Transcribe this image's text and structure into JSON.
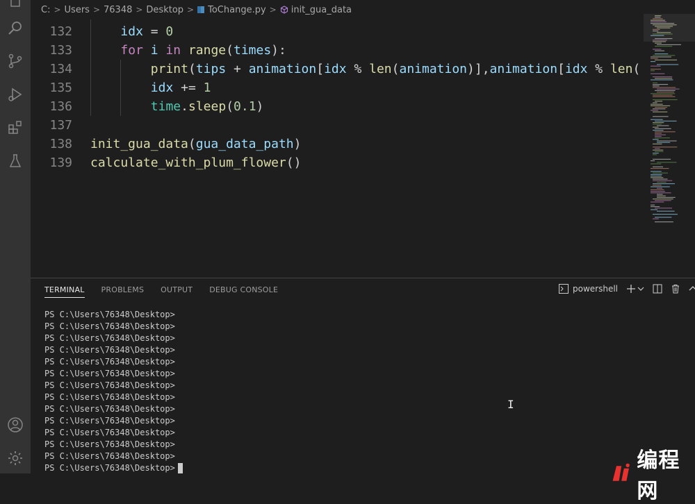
{
  "breadcrumb": {
    "items": [
      "C:",
      "Users",
      "76348",
      "Desktop",
      "ToChange.py",
      "init_gua_data"
    ],
    "separator": ">"
  },
  "editor": {
    "lines": [
      {
        "num": "132",
        "tokens": [
          {
            "t": "idx",
            "c": "vr"
          },
          {
            "t": " = ",
            "c": "op"
          },
          {
            "t": "0",
            "c": "nm"
          }
        ]
      },
      {
        "num": "133",
        "tokens": [
          {
            "t": "for",
            "c": "kw"
          },
          {
            "t": " ",
            "c": "pl"
          },
          {
            "t": "i",
            "c": "vr"
          },
          {
            "t": " in ",
            "c": "kw"
          },
          {
            "t": "range",
            "c": "fn"
          },
          {
            "t": "(",
            "c": "pl"
          },
          {
            "t": "times",
            "c": "vr"
          },
          {
            "t": "):",
            "c": "pl"
          }
        ]
      },
      {
        "num": "134",
        "tokens": [
          {
            "t": "print",
            "c": "fn"
          },
          {
            "t": "(",
            "c": "pl"
          },
          {
            "t": "tips",
            "c": "vr"
          },
          {
            "t": " + ",
            "c": "op"
          },
          {
            "t": "animation",
            "c": "vr"
          },
          {
            "t": "[",
            "c": "pl"
          },
          {
            "t": "idx",
            "c": "vr"
          },
          {
            "t": " % ",
            "c": "op"
          },
          {
            "t": "len",
            "c": "fn"
          },
          {
            "t": "(",
            "c": "pl"
          },
          {
            "t": "animation",
            "c": "vr"
          },
          {
            "t": ")],",
            "c": "pl"
          },
          {
            "t": "animation",
            "c": "vr"
          },
          {
            "t": "[",
            "c": "pl"
          },
          {
            "t": "idx",
            "c": "vr"
          },
          {
            "t": " % ",
            "c": "op"
          },
          {
            "t": "len",
            "c": "fn"
          },
          {
            "t": "(",
            "c": "pl"
          }
        ]
      },
      {
        "num": "135",
        "tokens": [
          {
            "t": "idx",
            "c": "vr"
          },
          {
            "t": " += ",
            "c": "op"
          },
          {
            "t": "1",
            "c": "nm"
          }
        ]
      },
      {
        "num": "136",
        "tokens": [
          {
            "t": "time",
            "c": "bi"
          },
          {
            "t": ".",
            "c": "pl"
          },
          {
            "t": "sleep",
            "c": "fn"
          },
          {
            "t": "(",
            "c": "pl"
          },
          {
            "t": "0.1",
            "c": "nm"
          },
          {
            "t": ")",
            "c": "pl"
          }
        ]
      },
      {
        "num": "137",
        "tokens": []
      },
      {
        "num": "138",
        "tokens": [
          {
            "t": "init_gua_data",
            "c": "fn"
          },
          {
            "t": "(",
            "c": "pl"
          },
          {
            "t": "gua_data_path",
            "c": "vr"
          },
          {
            "t": ")",
            "c": "pl"
          }
        ]
      },
      {
        "num": "139",
        "tokens": [
          {
            "t": "calculate_with_plum_flower",
            "c": "fn"
          },
          {
            "t": "()",
            "c": "pl"
          }
        ]
      }
    ]
  },
  "panel": {
    "tabs": [
      "TERMINAL",
      "PROBLEMS",
      "OUTPUT",
      "DEBUG CONSOLE"
    ],
    "active_tab": "TERMINAL",
    "shell_label": "powershell"
  },
  "terminal": {
    "prompt": "PS C:\\Users\\76348\\Desktop>",
    "lines": [
      "PS C:\\Users\\76348\\Desktop>",
      "PS C:\\Users\\76348\\Desktop>",
      "PS C:\\Users\\76348\\Desktop>",
      "PS C:\\Users\\76348\\Desktop>",
      "PS C:\\Users\\76348\\Desktop>",
      "PS C:\\Users\\76348\\Desktop>",
      "PS C:\\Users\\76348\\Desktop>",
      "PS C:\\Users\\76348\\Desktop>",
      "PS C:\\Users\\76348\\Desktop>",
      "PS C:\\Users\\76348\\Desktop>",
      "PS C:\\Users\\76348\\Desktop>",
      "PS C:\\Users\\76348\\Desktop>",
      "PS C:\\Users\\76348\\Desktop>",
      "PS C:\\Users\\76348\\Desktop>"
    ]
  },
  "watermark": {
    "text": "编程网"
  },
  "colors": {
    "background": "#1e1e1e",
    "activity_bar": "#333333",
    "accent": "#007acc"
  }
}
